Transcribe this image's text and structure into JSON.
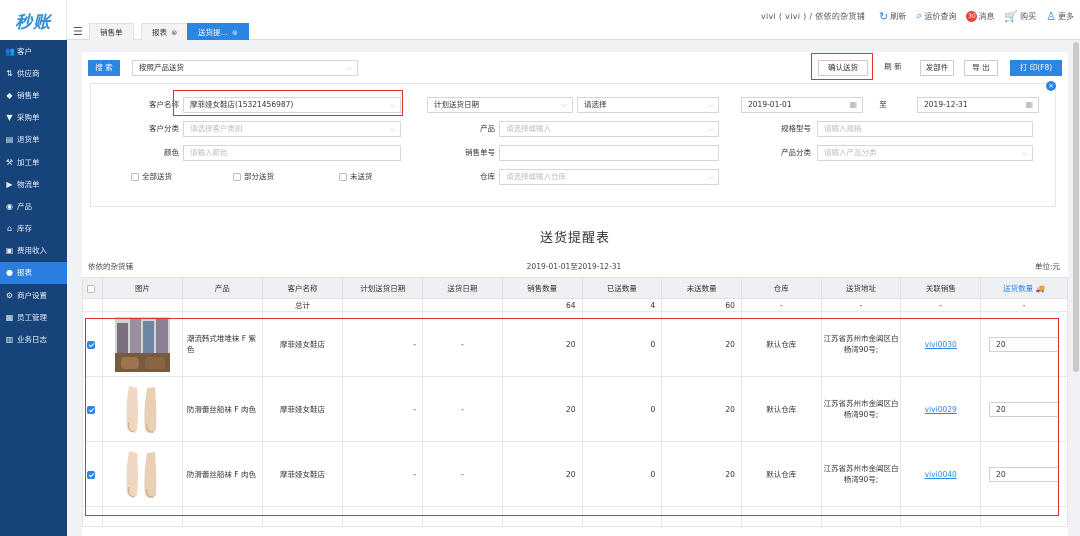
{
  "app": {
    "logo": "秒账",
    "user": "vivi ( vivi ) / 依依的杂货铺"
  },
  "topnav": [
    {
      "icon": "refresh-icon",
      "label": "刷新"
    },
    {
      "icon": "search-icon",
      "label": "运价查询"
    },
    {
      "icon": "message-icon",
      "label": "消息",
      "badge": "30"
    },
    {
      "icon": "cart-icon",
      "label": "购买"
    },
    {
      "icon": "user-icon",
      "label": "更多"
    }
  ],
  "tabs": [
    {
      "label": "销售单"
    },
    {
      "label": "报表"
    },
    {
      "label": "送货提..."
    }
  ],
  "sidebar": [
    {
      "icon": "customer-icon",
      "label": "客户"
    },
    {
      "icon": "supplier-icon",
      "label": "供应商"
    },
    {
      "icon": "sales-icon",
      "label": "销售单"
    },
    {
      "icon": "purchase-icon",
      "label": "采购单"
    },
    {
      "icon": "return-icon",
      "label": "退货单"
    },
    {
      "icon": "process-icon",
      "label": "加工单"
    },
    {
      "icon": "logistics-icon",
      "label": "物流单"
    },
    {
      "icon": "product-icon",
      "label": "产品"
    },
    {
      "icon": "stock-icon",
      "label": "库存"
    },
    {
      "icon": "expense-icon",
      "label": "费用收入"
    },
    {
      "icon": "report-icon",
      "label": "报表"
    },
    {
      "icon": "settings-icon",
      "label": "商户设置"
    },
    {
      "icon": "staff-icon",
      "label": "员工管理"
    },
    {
      "icon": "log-icon",
      "label": "业务日志"
    }
  ],
  "search": {
    "button": "搜 索",
    "mode": "按照产品送货"
  },
  "actions": {
    "confirm": "确认送货",
    "refresh": "刷 新",
    "ship": "发部件",
    "export": "导 出",
    "print": "打 印(F8)"
  },
  "filter": {
    "customer_label": "客户名称",
    "customer_value": "摩菲娅女鞋店(15321456987)",
    "plan_date": "计划送货日期",
    "plan_select": "请选择",
    "date_from": "2019-01-01",
    "to": "至",
    "date_to": "2019-12-31",
    "category_label": "客户分类",
    "category_ph": "请选择客户类别",
    "product_label": "产品",
    "product_ph": "请选择或输入",
    "spec_label": "规格型号",
    "spec_ph": "请输入规格",
    "color_label": "颜色",
    "color_ph": "请输入颜色",
    "order_label": "销售单号",
    "pcat_label": "产品分类",
    "pcat_ph": "请输入产品分类",
    "cb_all": "全部送货",
    "cb_part": "部分送货",
    "cb_none": "未送货",
    "wh_label": "仓库",
    "wh_ph": "请选择或输入仓库"
  },
  "report": {
    "title": "送货提醒表",
    "shop": "依依的杂货铺",
    "range": "2019-01-01至2019-12-31",
    "unit": "单位:元"
  },
  "table": {
    "headers": [
      "图片",
      "产品",
      "客户名称",
      "计划送货日期",
      "送货日期",
      "销售数量",
      "已送数量",
      "未送数量",
      "仓库",
      "送货地址",
      "关联销售",
      "送货数量"
    ],
    "total": {
      "label": "总计",
      "sales": "64",
      "sent": "4",
      "unsent": "60",
      "warehouse": "-",
      "address": "-",
      "link": "-",
      "qty": "-"
    },
    "rows": [
      {
        "product": "潮流韩式堆堆袜 F 紫色",
        "customer": "摩菲娅女鞋店",
        "plan": "-",
        "date": "-",
        "sales": "20",
        "sent": "0",
        "unsent": "20",
        "warehouse": "默认仓库",
        "address": "江苏省苏州市金阊区白杨湾90号;",
        "link": "vivi0030",
        "qty": "20"
      },
      {
        "product": "防滑蕾丝船袜 F 肉色",
        "customer": "摩菲娅女鞋店",
        "plan": "-",
        "date": "-",
        "sales": "20",
        "sent": "0",
        "unsent": "20",
        "warehouse": "默认仓库",
        "address": "江苏省苏州市金阊区白杨湾90号;",
        "link": "vivi0029",
        "qty": "20"
      },
      {
        "product": "防滑蕾丝船袜 F 肉色",
        "customer": "摩菲娅女鞋店",
        "plan": "-",
        "date": "-",
        "sales": "20",
        "sent": "0",
        "unsent": "20",
        "warehouse": "默认仓库",
        "address": "江苏省苏州市金阊区白杨湾90号;",
        "link": "vivi0040",
        "qty": "20"
      }
    ]
  }
}
